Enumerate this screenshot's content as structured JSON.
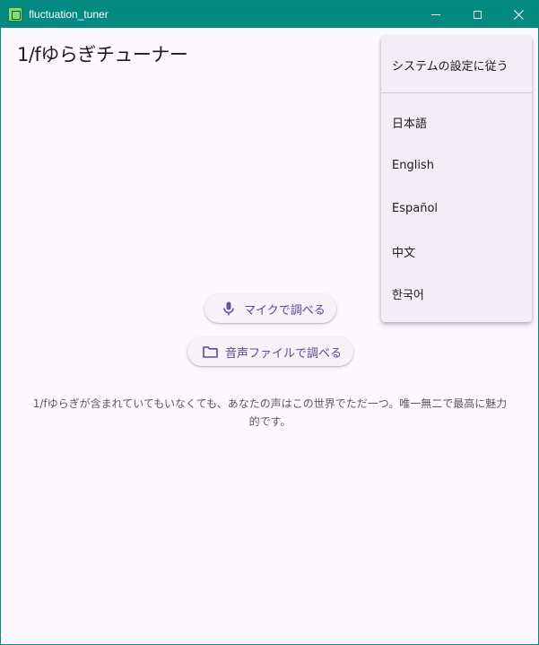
{
  "window": {
    "title": "fluctuation_tuner",
    "titlebar_color": "#038a82",
    "controls": [
      "minimize-icon",
      "maximize-icon",
      "close-icon"
    ]
  },
  "app": {
    "title": "1/fゆらぎチューナー"
  },
  "actions": {
    "mic_label": "マイクで調べる",
    "file_label": "音声ファイルで調べる",
    "mic_icon": "microphone-icon",
    "file_icon": "folder-icon",
    "accent_color": "#6750a4"
  },
  "message": "1/fゆらぎが含まれていてもいなくても、あなたの声はこの世界でただ一つ。唯一無二で最高に魅力的です。",
  "language_menu": {
    "system_option": "システムの設定に従う",
    "options": [
      "日本語",
      "English",
      "Español",
      "中文",
      "한국어"
    ]
  }
}
